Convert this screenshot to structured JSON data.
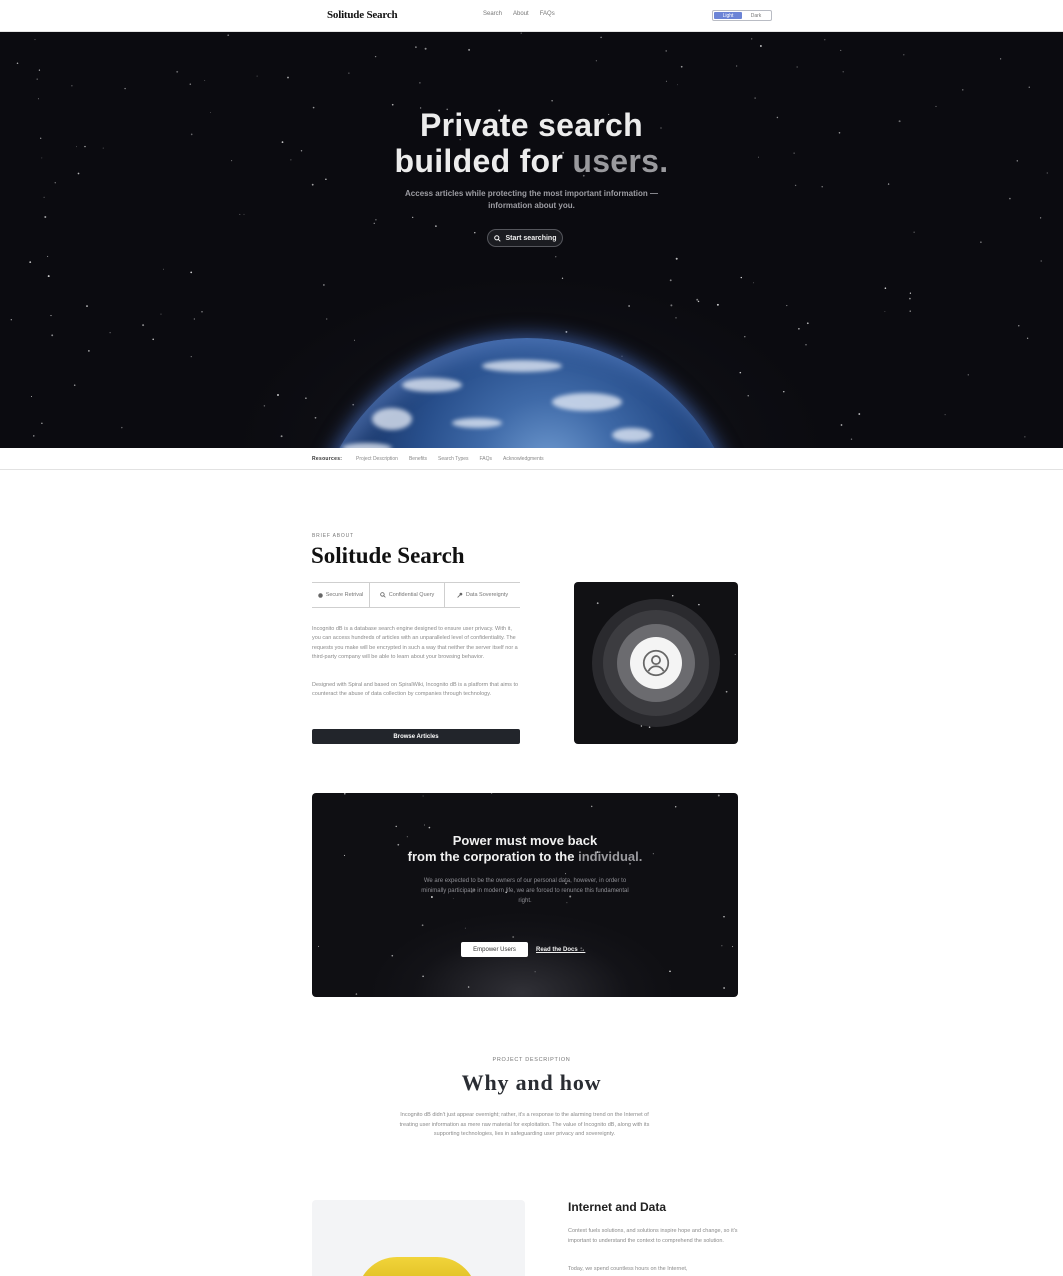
{
  "nav": {
    "brand": "Solitude Search",
    "links": [
      "Search",
      "About",
      "FAQs"
    ],
    "theme": {
      "light": "Light",
      "dark": "Dark",
      "selected": "Light"
    }
  },
  "hero": {
    "title_line1": "Private search",
    "title_line2_a": "builded for ",
    "title_line2_b": "users.",
    "subtitle": "Access articles while protecting the most important information — information about you.",
    "cta": "Start searching"
  },
  "resources": {
    "label": "Resources:",
    "links": [
      "Project Description",
      "Benefits",
      "Search Types",
      "FAQs",
      "Acknowledgments"
    ]
  },
  "about": {
    "kicker": "BRIEF ABOUT",
    "title": "Solitude Search",
    "tabs": [
      "Secure Retrival",
      "Confidential Query",
      "Data Sovereignty"
    ],
    "paragraph1": "Incognito dB is a database search engine designed to ensure user privacy. With it, you can access hundreds of articles with an unparalleled level of confidentiality. The requests you make will be encrypted in such a way that neither the server itself nor a third-party company will be able to learn about your browsing behavior.",
    "paragraph2": "Designed with Spiral and based on SpiralWiki, Incognito dB is a platform that aims to counteract the abuse of data collection by companies through technology.",
    "button": "Browse Articles"
  },
  "power": {
    "title_line1": "Power must move back",
    "title_line2_a": "from the corporation to the ",
    "title_line2_b": "individual.",
    "subtitle": "We are expected to be the owners of our personal data, however, in order to minimally participate in modern life, we are forced to renunce this fundamental right.",
    "primary_button": "Empower Users",
    "secondary_link": "Read the Docs →"
  },
  "project": {
    "kicker": "PROJECT DESCRIPTION",
    "title": "Why and how",
    "text": "Incognito dB didn't just appear overnight; rather, it's a response to the alarming trend on the Internet of treating user information as mere raw material for exploitation. The value of Incognito dB, along with its supporting technologies, lies in safeguarding user privacy and sovereignty."
  },
  "internet": {
    "title": "Internet and Data",
    "paragraph1": "Context fuels solutions, and solutions inspire hope and change, so it's important to understand the context to comprehend the solution.",
    "paragraph2": "Today, we spend countless hours on the Internet,"
  },
  "icons": [
    "search-icon",
    "user-icon",
    "lock-icon",
    "key-icon"
  ]
}
